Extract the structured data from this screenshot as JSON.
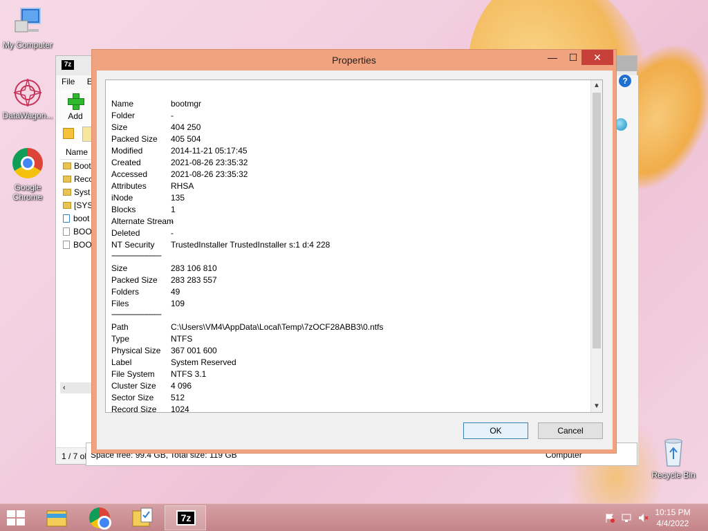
{
  "desktop": {
    "icons": [
      {
        "label": "My Computer",
        "icon": "computer-icon"
      },
      {
        "label": "DataWagon...",
        "icon": "datawagon-icon"
      },
      {
        "label": "Google Chrome",
        "icon": "chrome-icon"
      },
      {
        "label": "Recycle Bin",
        "icon": "recycle-bin-icon"
      }
    ]
  },
  "bg_window": {
    "menu": {
      "file": "File",
      "edit": "E"
    },
    "toolbar": {
      "add_label": "Add"
    },
    "list_header": "Name",
    "rows": [
      "Boot",
      "Reco",
      "Syst",
      "[SYS",
      "boot",
      "BOO",
      "BOO"
    ],
    "status": "1 / 7 obj",
    "status_bottom": "Space free: 99.4 GB, Total size: 119 GB",
    "status_right": "Computer"
  },
  "dialog": {
    "title": "Properties",
    "controls": {
      "min": "—",
      "max": "☐",
      "close": "✕"
    },
    "rows1": [
      {
        "k": "Name",
        "v": "bootmgr"
      },
      {
        "k": "Folder",
        "v": "-"
      },
      {
        "k": "Size",
        "v": "404 250"
      },
      {
        "k": "Packed Size",
        "v": "405 504"
      },
      {
        "k": "Modified",
        "v": "2014-11-21 05:17:45"
      },
      {
        "k": "Created",
        "v": "2021-08-26 23:35:32"
      },
      {
        "k": "Accessed",
        "v": "2021-08-26 23:35:32"
      },
      {
        "k": "Attributes",
        "v": "RHSA"
      },
      {
        "k": "iNode",
        "v": "135"
      },
      {
        "k": "Blocks",
        "v": "1"
      },
      {
        "k": "Alternate Stream",
        "v": "-"
      },
      {
        "k": "Deleted",
        "v": "-"
      },
      {
        "k": "NT Security",
        "v": "TrustedInstaller TrustedInstaller s:1 d:4 228"
      }
    ],
    "separator": "------------------------",
    "rows2": [
      {
        "k": "Size",
        "v": "283 106 810"
      },
      {
        "k": "Packed Size",
        "v": "283 283 557"
      },
      {
        "k": "Folders",
        "v": "49"
      },
      {
        "k": "Files",
        "v": "109"
      }
    ],
    "rows3": [
      {
        "k": "Path",
        "v": "C:\\Users\\VM4\\AppData\\Local\\Temp\\7zOCF28ABB3\\0.ntfs"
      },
      {
        "k": "Type",
        "v": "NTFS"
      },
      {
        "k": "Physical Size",
        "v": "367 001 600"
      },
      {
        "k": "Label",
        "v": "System Reserved"
      },
      {
        "k": "File System",
        "v": "NTFS 3.1"
      },
      {
        "k": "Cluster Size",
        "v": "4 096"
      },
      {
        "k": "Sector Size",
        "v": "512"
      },
      {
        "k": "Record Size",
        "v": "1024"
      }
    ],
    "ok_label": "OK",
    "cancel_label": "Cancel"
  },
  "taskbar": {
    "time": "10:15 PM",
    "date": "4/4/2022",
    "items": [
      "start-button",
      "file-explorer",
      "google-chrome",
      "folder-tasks",
      "7-zip"
    ]
  }
}
